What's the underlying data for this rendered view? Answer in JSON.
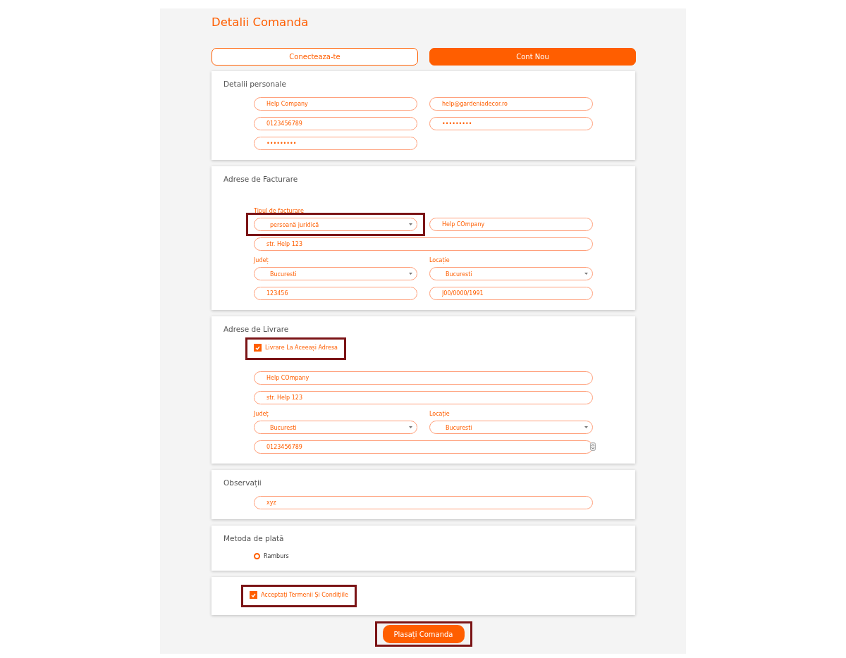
{
  "title": "Detalii Comanda",
  "auth_tabs": [
    {
      "label": "Conecteaza-te",
      "selected": false
    },
    {
      "label": "Cont Nou",
      "selected": true
    }
  ],
  "sections": [
    {
      "title": "Detalii personale",
      "items": [
        {
          "kind": "fields",
          "wide": false,
          "fields": [
            {
              "kind": "text",
              "value": "Help Company"
            },
            {
              "kind": "text",
              "value": "help@gardeniadecor.ro"
            }
          ]
        },
        {
          "kind": "fields",
          "wide": false,
          "fields": [
            {
              "kind": "text",
              "value": "0123456789"
            },
            {
              "kind": "password",
              "value": "•••••••••"
            }
          ]
        },
        {
          "kind": "fields",
          "wide": false,
          "fields": [
            {
              "kind": "password",
              "value": "•••••••••"
            }
          ]
        }
      ]
    },
    {
      "title": "Adrese de Facturare",
      "items": [
        {
          "kind": "fields",
          "wide": false,
          "fields": [
            {
              "kind": "select",
              "label": "Tipul de facturare",
              "value": "persoană juridică",
              "highlighted": true
            },
            {
              "kind": "text",
              "value": "Help COmpany"
            }
          ]
        },
        {
          "kind": "fields",
          "wide": true,
          "fields": [
            {
              "kind": "text",
              "value": "str. Help 123"
            }
          ]
        },
        {
          "kind": "fields",
          "wide": false,
          "fields": [
            {
              "kind": "select",
              "label": "Județ",
              "value": "Bucuresti"
            },
            {
              "kind": "select",
              "label": "Locație",
              "value": "Bucuresti"
            }
          ]
        },
        {
          "kind": "fields",
          "wide": false,
          "fields": [
            {
              "kind": "text",
              "value": "123456"
            },
            {
              "kind": "text",
              "value": "J00/0000/1991"
            }
          ]
        }
      ]
    },
    {
      "title": "Adrese de Livrare",
      "items": [
        {
          "kind": "checkbox",
          "label": "Livrare La Aceeași Adresa",
          "checked": true,
          "highlighted": true
        },
        {
          "kind": "fields",
          "wide": true,
          "fields": [
            {
              "kind": "text",
              "value": "Help COmpany"
            }
          ]
        },
        {
          "kind": "fields",
          "wide": true,
          "fields": [
            {
              "kind": "text",
              "value": "str. Help 123"
            }
          ]
        },
        {
          "kind": "fields",
          "wide": false,
          "fields": [
            {
              "kind": "select",
              "label": "Județ",
              "value": "Bucuresti"
            },
            {
              "kind": "select",
              "label": "Locație",
              "value": "Bucuresti"
            }
          ]
        },
        {
          "kind": "fields",
          "wide": true,
          "fields": [
            {
              "kind": "number",
              "value": "0123456789"
            }
          ]
        }
      ]
    },
    {
      "title": "Observații",
      "items": [
        {
          "kind": "fields",
          "wide": true,
          "fields": [
            {
              "kind": "text",
              "value": "xyz"
            }
          ]
        }
      ]
    },
    {
      "title": "Metoda de plată",
      "items": [
        {
          "kind": "radio",
          "label": "Ramburs",
          "selected": true
        }
      ]
    },
    {
      "items": [
        {
          "kind": "checkbox",
          "label": "Acceptați Termenii Și Condițiile",
          "checked": true,
          "highlighted": true
        }
      ]
    }
  ],
  "submit": {
    "label": "Plasați Comanda",
    "highlighted": true
  }
}
